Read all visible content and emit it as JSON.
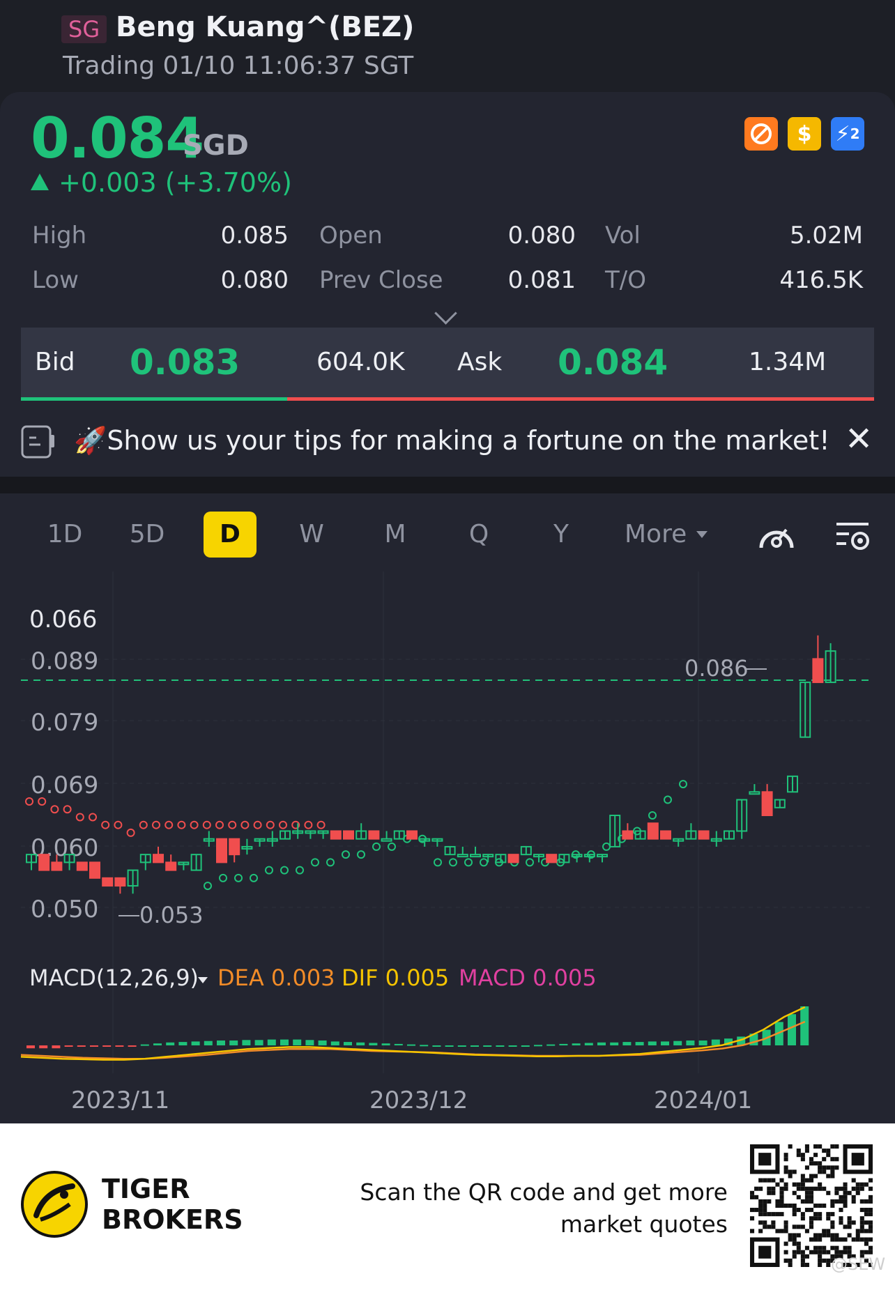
{
  "header": {
    "market": "SG",
    "title": "Beng Kuang^(BEZ)",
    "status": "Trading 01/10 11:06:37 SGT"
  },
  "quote": {
    "price": "0.084",
    "currency": "SGD",
    "change": "+0.003 (+3.70%)",
    "badges": [
      {
        "icon": "no-short-icon",
        "color": "#ff7a1f"
      },
      {
        "icon": "dollar-icon",
        "color": "#f5b800",
        "label": "$"
      },
      {
        "icon": "flash-2x-icon",
        "color": "#2f7cf6",
        "label": "⚡"
      }
    ],
    "stats": {
      "high_label": "High",
      "high": "0.085",
      "low_label": "Low",
      "low": "0.080",
      "open_label": "Open",
      "open": "0.080",
      "prev_label": "Prev Close",
      "prev": "0.081",
      "vol_label": "Vol",
      "vol": "5.02M",
      "to_label": "T/O",
      "to": "416.5K"
    }
  },
  "bidask": {
    "bid_label": "Bid",
    "bid": "0.083",
    "bid_size": "604.0K",
    "ask_label": "Ask",
    "ask": "0.084",
    "ask_size": "1.34M",
    "bid_ratio": 0.31
  },
  "promo": {
    "text": "🚀Show us your tips for making a fortune on the market!"
  },
  "tabs": [
    "1D",
    "5D",
    "D",
    "W",
    "M",
    "Q",
    "Y",
    "More"
  ],
  "active_tab": "D",
  "chart_data": {
    "type": "candlestick",
    "yaxis_labels": [
      "0.066",
      "0.089",
      "0.079",
      "0.069",
      "0.060",
      "0.050"
    ],
    "high_marker": "0.086",
    "low_marker": "0.053",
    "xaxis_labels": [
      "2023/11",
      "2023/12",
      "2024/01"
    ],
    "candles": [
      {
        "o": 0.057,
        "h": 0.058,
        "l": 0.056,
        "c": 0.058
      },
      {
        "o": 0.058,
        "h": 0.058,
        "l": 0.056,
        "c": 0.056
      },
      {
        "o": 0.057,
        "h": 0.058,
        "l": 0.056,
        "c": 0.056
      },
      {
        "o": 0.057,
        "h": 0.058,
        "l": 0.056,
        "c": 0.058
      },
      {
        "o": 0.057,
        "h": 0.057,
        "l": 0.056,
        "c": 0.056
      },
      {
        "o": 0.057,
        "h": 0.057,
        "l": 0.055,
        "c": 0.055
      },
      {
        "o": 0.055,
        "h": 0.055,
        "l": 0.054,
        "c": 0.054
      },
      {
        "o": 0.055,
        "h": 0.055,
        "l": 0.053,
        "c": 0.054
      },
      {
        "o": 0.054,
        "h": 0.056,
        "l": 0.053,
        "c": 0.056
      },
      {
        "o": 0.057,
        "h": 0.058,
        "l": 0.056,
        "c": 0.058
      },
      {
        "o": 0.058,
        "h": 0.059,
        "l": 0.057,
        "c": 0.057
      },
      {
        "o": 0.057,
        "h": 0.058,
        "l": 0.056,
        "c": 0.056
      },
      {
        "o": 0.057,
        "h": 0.057,
        "l": 0.056,
        "c": 0.057
      },
      {
        "o": 0.056,
        "h": 0.058,
        "l": 0.056,
        "c": 0.058
      },
      {
        "o": 0.06,
        "h": 0.061,
        "l": 0.059,
        "c": 0.06
      },
      {
        "o": 0.06,
        "h": 0.06,
        "l": 0.057,
        "c": 0.057
      },
      {
        "o": 0.06,
        "h": 0.06,
        "l": 0.057,
        "c": 0.058
      },
      {
        "o": 0.059,
        "h": 0.06,
        "l": 0.058,
        "c": 0.059
      },
      {
        "o": 0.06,
        "h": 0.06,
        "l": 0.059,
        "c": 0.06
      },
      {
        "o": 0.06,
        "h": 0.061,
        "l": 0.059,
        "c": 0.06
      },
      {
        "o": 0.06,
        "h": 0.061,
        "l": 0.06,
        "c": 0.061
      },
      {
        "o": 0.061,
        "h": 0.062,
        "l": 0.06,
        "c": 0.061
      },
      {
        "o": 0.061,
        "h": 0.061,
        "l": 0.06,
        "c": 0.061
      },
      {
        "o": 0.061,
        "h": 0.061,
        "l": 0.06,
        "c": 0.061
      },
      {
        "o": 0.061,
        "h": 0.061,
        "l": 0.06,
        "c": 0.06
      },
      {
        "o": 0.061,
        "h": 0.061,
        "l": 0.06,
        "c": 0.06
      },
      {
        "o": 0.06,
        "h": 0.062,
        "l": 0.06,
        "c": 0.061
      },
      {
        "o": 0.061,
        "h": 0.061,
        "l": 0.06,
        "c": 0.06
      },
      {
        "o": 0.06,
        "h": 0.061,
        "l": 0.06,
        "c": 0.06
      },
      {
        "o": 0.06,
        "h": 0.061,
        "l": 0.06,
        "c": 0.061
      },
      {
        "o": 0.061,
        "h": 0.061,
        "l": 0.06,
        "c": 0.06
      },
      {
        "o": 0.06,
        "h": 0.06,
        "l": 0.059,
        "c": 0.06
      },
      {
        "o": 0.06,
        "h": 0.06,
        "l": 0.059,
        "c": 0.06
      },
      {
        "o": 0.058,
        "h": 0.059,
        "l": 0.058,
        "c": 0.059
      },
      {
        "o": 0.058,
        "h": 0.059,
        "l": 0.058,
        "c": 0.058
      },
      {
        "o": 0.058,
        "h": 0.059,
        "l": 0.058,
        "c": 0.058
      },
      {
        "o": 0.058,
        "h": 0.058,
        "l": 0.057,
        "c": 0.058
      },
      {
        "o": 0.057,
        "h": 0.058,
        "l": 0.057,
        "c": 0.058
      },
      {
        "o": 0.058,
        "h": 0.058,
        "l": 0.057,
        "c": 0.057
      },
      {
        "o": 0.058,
        "h": 0.059,
        "l": 0.058,
        "c": 0.059
      },
      {
        "o": 0.058,
        "h": 0.058,
        "l": 0.057,
        "c": 0.058
      },
      {
        "o": 0.058,
        "h": 0.058,
        "l": 0.057,
        "c": 0.057
      },
      {
        "o": 0.057,
        "h": 0.058,
        "l": 0.057,
        "c": 0.058
      },
      {
        "o": 0.058,
        "h": 0.058,
        "l": 0.057,
        "c": 0.058
      },
      {
        "o": 0.058,
        "h": 0.058,
        "l": 0.057,
        "c": 0.058
      },
      {
        "o": 0.058,
        "h": 0.058,
        "l": 0.057,
        "c": 0.058
      },
      {
        "o": 0.059,
        "h": 0.063,
        "l": 0.059,
        "c": 0.063
      },
      {
        "o": 0.061,
        "h": 0.062,
        "l": 0.06,
        "c": 0.06
      },
      {
        "o": 0.06,
        "h": 0.061,
        "l": 0.06,
        "c": 0.061
      },
      {
        "o": 0.062,
        "h": 0.062,
        "l": 0.06,
        "c": 0.06
      },
      {
        "o": 0.061,
        "h": 0.061,
        "l": 0.06,
        "c": 0.06
      },
      {
        "o": 0.06,
        "h": 0.06,
        "l": 0.059,
        "c": 0.06
      },
      {
        "o": 0.06,
        "h": 0.062,
        "l": 0.06,
        "c": 0.061
      },
      {
        "o": 0.061,
        "h": 0.061,
        "l": 0.06,
        "c": 0.06
      },
      {
        "o": 0.06,
        "h": 0.061,
        "l": 0.059,
        "c": 0.06
      },
      {
        "o": 0.06,
        "h": 0.061,
        "l": 0.06,
        "c": 0.061
      },
      {
        "o": 0.061,
        "h": 0.065,
        "l": 0.06,
        "c": 0.065
      },
      {
        "o": 0.066,
        "h": 0.067,
        "l": 0.066,
        "c": 0.066
      },
      {
        "o": 0.066,
        "h": 0.067,
        "l": 0.063,
        "c": 0.063
      },
      {
        "o": 0.064,
        "h": 0.065,
        "l": 0.064,
        "c": 0.065
      },
      {
        "o": 0.066,
        "h": 0.068,
        "l": 0.066,
        "c": 0.068
      },
      {
        "o": 0.073,
        "h": 0.08,
        "l": 0.073,
        "c": 0.08
      },
      {
        "o": 0.083,
        "h": 0.086,
        "l": 0.08,
        "c": 0.08
      },
      {
        "o": 0.08,
        "h": 0.085,
        "l": 0.08,
        "c": 0.084
      }
    ],
    "sar_red": [
      0.063,
      0.063,
      0.062,
      0.062,
      0.061,
      0.061,
      0.06,
      0.06,
      0.059,
      0.06,
      0.06,
      0.06,
      0.06,
      0.06,
      0.06,
      0.06,
      0.06,
      0.06,
      0.06,
      0.06,
      0.06,
      0.06,
      0.06,
      0.06
    ],
    "sar_green": [
      0.054,
      0.055,
      0.055,
      0.055,
      0.056,
      0.056,
      0.056,
      0.057,
      0.057,
      0.058,
      0.058,
      0.059,
      0.059,
      0.06,
      0.06,
      0.057,
      0.057,
      0.057,
      0.057,
      0.057,
      0.057,
      0.057,
      0.057,
      0.057,
      0.058,
      0.058,
      0.059,
      0.06,
      0.061,
      0.063,
      0.065,
      0.067
    ],
    "macd": {
      "title": "MACD(12,26,9)",
      "dea_label": "DEA 0.003",
      "dif_label": "DIF 0.005",
      "macd_label": "MACD 0.005",
      "colors": {
        "dea": "#f28c28",
        "dif": "#f5c400",
        "macd": "#e040a0"
      },
      "hist": [
        -0.3,
        -0.3,
        -0.3,
        -0.1,
        -0.1,
        -0.1,
        -0.1,
        -0.1,
        -0.1,
        0.1,
        0.2,
        0.3,
        0.35,
        0.4,
        0.45,
        0.5,
        0.5,
        0.55,
        0.55,
        0.6,
        0.6,
        0.6,
        0.55,
        0.5,
        0.4,
        0.35,
        0.3,
        0.25,
        0.2,
        0.15,
        0.1,
        0.05,
        0.0,
        0.0,
        0.0,
        0.0,
        0.0,
        0.0,
        0.0,
        0.0,
        0.05,
        0.1,
        0.15,
        0.2,
        0.25,
        0.3,
        0.3,
        0.35,
        0.35,
        0.4,
        0.4,
        0.45,
        0.5,
        0.5,
        0.6,
        0.7,
        0.9,
        1.2,
        1.6,
        2.4,
        3.2,
        4.0
      ],
      "dif": [
        0.4,
        0.3,
        0.2,
        0.15,
        0.1,
        0.1,
        0.2,
        0.4,
        0.6,
        0.8,
        1.0,
        1.2,
        1.3,
        1.4,
        1.4,
        1.3,
        1.2,
        1.1,
        1.0,
        0.9,
        0.8,
        0.7,
        0.6,
        0.55,
        0.5,
        0.45,
        0.45,
        0.5,
        0.5,
        0.6,
        0.7,
        0.9,
        1.1,
        1.3,
        1.6,
        2.2,
        3.2,
        4.5,
        5.5
      ],
      "dea": [
        0.6,
        0.5,
        0.4,
        0.3,
        0.25,
        0.2,
        0.2,
        0.3,
        0.45,
        0.6,
        0.8,
        1.0,
        1.1,
        1.2,
        1.2,
        1.2,
        1.1,
        1.0,
        0.95,
        0.9,
        0.85,
        0.75,
        0.65,
        0.6,
        0.55,
        0.5,
        0.5,
        0.5,
        0.5,
        0.55,
        0.6,
        0.75,
        0.9,
        1.05,
        1.25,
        1.6,
        2.2,
        3.1,
        4.0
      ]
    }
  },
  "footer": {
    "brand_line1": "TIGER",
    "brand_line2": "BROKERS",
    "scan_line1": "Scan the QR code and get more",
    "scan_line2": "market quotes",
    "watermark": "@SEW"
  }
}
